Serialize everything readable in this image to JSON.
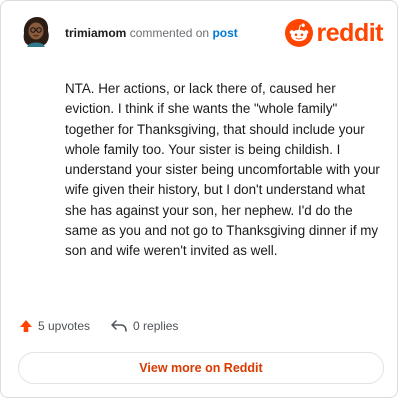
{
  "comment": {
    "username": "trimiamom",
    "verb": "commented on",
    "link_text": "post",
    "body": "NTA. Her actions, or lack there of, caused her eviction. I think if she wants the \"whole family\" together for Thanksgiving, that should include your whole family too. Your sister is being childish. I understand your sister being uncomfortable with your wife given their history, but I don't understand what she has against your son, her nephew. I'd do the same as you and not go to Thanksgiving dinner if my son and wife weren't invited as well."
  },
  "brand": {
    "logo_text": "reddit",
    "accent_color": "#ff4500",
    "icon": "reddit-snoo-icon"
  },
  "stats": {
    "upvotes_label": "5 upvotes",
    "replies_label": "0 replies",
    "upvote_icon": "upvote-arrow-icon",
    "reply_icon": "reply-arrow-icon"
  },
  "actions": {
    "view_more_label": "View more on Reddit"
  }
}
